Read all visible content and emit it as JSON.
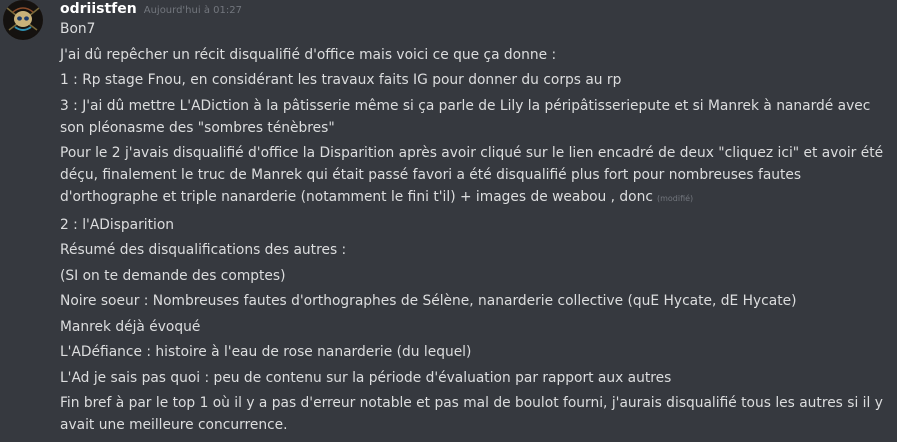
{
  "message": {
    "username": "odriistfen",
    "timestamp": "Aujourd'hui à 01:27",
    "edited_label": "(modifié)",
    "avatar_icon": "skull-sigil-icon",
    "colors": {
      "background": "#36393f",
      "username": "#ffffff",
      "text": "#dcddde",
      "muted": "#72767d"
    },
    "lines": [
      "Bon7",
      "J'ai dû repêcher un récit disqualifié d'office mais voici ce que ça donne :",
      "1 : Rp stage Fnou, en considérant les travaux faits IG pour donner du corps au rp",
      "3 : J'ai dû mettre L'ADiction à la pâtisserie même si ça parle de Lily la péripâtisseriepute et si Manrek à nanardé avec son pléonasme des \"sombres ténèbres\"",
      "Pour le 2 j'avais disqualifié d'office la Disparition après avoir cliqué sur le lien encadré de deux \"cliquez ici\" et avoir été déçu, finalement le truc de Manrek qui était passé favori a été disqualifié plus fort pour nombreuses fautes d'orthographe et triple nanarderie (notamment le fini t'il) + images de weabou , donc",
      "2 : l'ADisparition",
      "Résumé des disqualifications des autres :",
      "(SI on te demande des comptes)",
      "Noire soeur : Nombreuses fautes d'orthographes de Sélène, nanarderie collective (quE Hycate, dE Hycate)",
      "Manrek déjà évoqué",
      "L'ADéfiance : histoire à l'eau de rose  nanarderie (du lequel)",
      "L'Ad je sais pas quoi : peu de contenu sur la période d'évaluation par rapport aux autres",
      "Fin bref à par le top 1 où il y a pas d'erreur notable et pas mal de boulot fourni, j'aurais disqualifié tous les autres si il y avait une meilleure concurrence."
    ]
  }
}
